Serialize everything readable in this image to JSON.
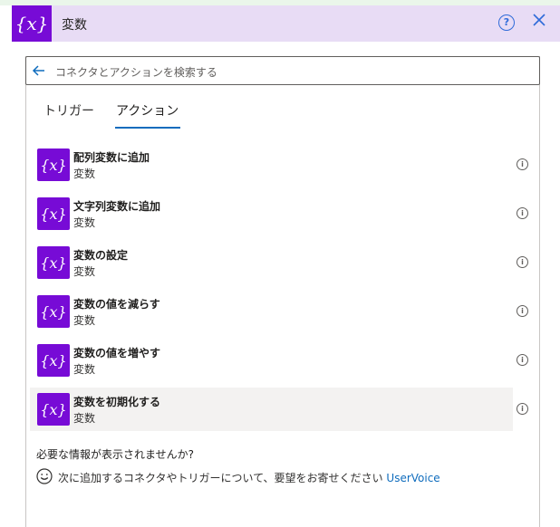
{
  "header": {
    "icon_text": "{x}",
    "title": "変数"
  },
  "search": {
    "placeholder": "コネクタとアクションを検索する"
  },
  "tabs": [
    {
      "label": "トリガー",
      "selected": false
    },
    {
      "label": "アクション",
      "selected": true
    }
  ],
  "actions": [
    {
      "name": "配列変数に追加",
      "connector": "変数",
      "icon_text": "{x}"
    },
    {
      "name": "文字列変数に追加",
      "connector": "変数",
      "icon_text": "{x}"
    },
    {
      "name": "変数の設定",
      "connector": "変数",
      "icon_text": "{x}"
    },
    {
      "name": "変数の値を減らす",
      "connector": "変数",
      "icon_text": "{x}"
    },
    {
      "name": "変数の値を増やす",
      "connector": "変数",
      "icon_text": "{x}"
    },
    {
      "name": "変数を初期化する",
      "connector": "変数",
      "icon_text": "{x}"
    }
  ],
  "footer": {
    "question": "必要な情報が表示されませんか?",
    "feedback_text": "次に追加するコネクタやトリガーについて、要望をお寄せください",
    "link_label": "UserVoice"
  },
  "colors": {
    "accent_purple": "#770bd6",
    "header_bg": "#e8dcf5",
    "link_blue": "#0f6cbd"
  },
  "icons": [
    "variable-icon",
    "help-icon",
    "close-icon",
    "back-arrow-icon",
    "info-icon",
    "smile-icon"
  ]
}
